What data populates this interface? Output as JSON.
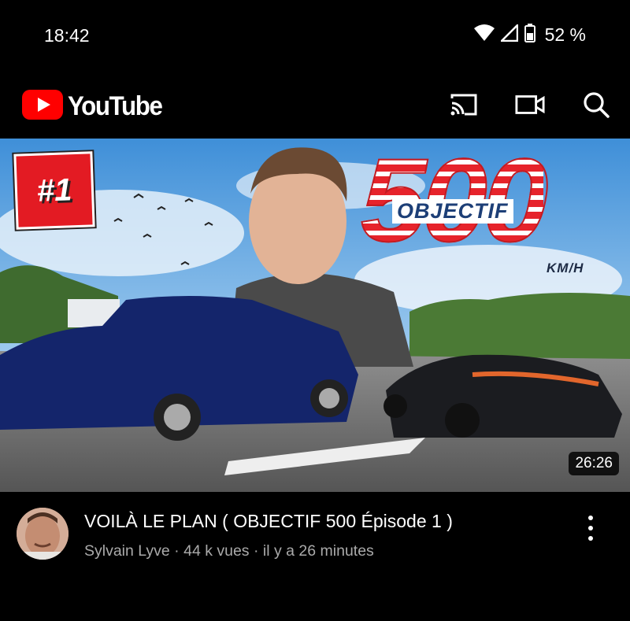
{
  "status_bar": {
    "time": "18:42",
    "battery": "52 %",
    "icons": [
      "wifi-icon",
      "cell-signal-icon",
      "battery-icon"
    ]
  },
  "app_bar": {
    "logo_text": "YouTube",
    "brand_color": "#ff0000",
    "icons": [
      "cast-icon",
      "video-camera-icon",
      "search-icon"
    ]
  },
  "video": {
    "thumbnail": {
      "badge": "#1",
      "big_number": "500",
      "overlay_title": "OBJECTIF",
      "unit": "KM/H",
      "duration": "26:26"
    },
    "title": "VOILÀ LE PLAN ( OBJECTIF 500 Épisode 1 )",
    "channel": "Sylvain Lyve",
    "views": "44 k vues",
    "age": "il y a 26 minutes",
    "separator": " · ",
    "menu_icon": "more-vertical-icon"
  }
}
